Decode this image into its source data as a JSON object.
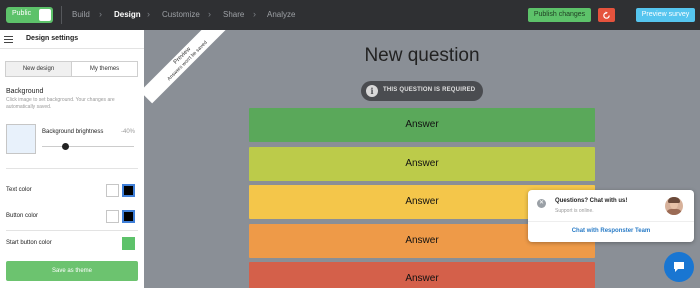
{
  "topbar": {
    "public_label": "Public",
    "nav": [
      {
        "label": "Build"
      },
      {
        "label": "Design"
      },
      {
        "label": "Customize"
      },
      {
        "label": "Share"
      },
      {
        "label": "Analyze"
      }
    ],
    "publish_label": "Publish changes",
    "preview_label": "Preview survey"
  },
  "sidebar": {
    "title": "Design settings",
    "tabs": [
      "New design",
      "My themes"
    ],
    "background_title": "Background",
    "background_desc": "Click image to set background. Your changes are automatically saved.",
    "brightness_label": "Background brightness",
    "brightness_value": "-40%",
    "brightness_fraction": 0.25,
    "text_color_label": "Text color",
    "button_color_label": "Button color",
    "start_button_color_label": "Start button color",
    "save_label": "Save as theme"
  },
  "preview": {
    "ribbon_line1": "Preview",
    "ribbon_line2": "Answers won't be saved",
    "question_title": "New question",
    "required_label": "THIS QUESTION IS REQUIRED",
    "answers": [
      {
        "label": "Answer",
        "color": "#5aa85a"
      },
      {
        "label": "Answer",
        "color": "#bccb4a"
      },
      {
        "label": "Answer",
        "color": "#f4c64a"
      },
      {
        "label": "Answer",
        "color": "#ee9a48"
      },
      {
        "label": "Answer",
        "color": "#d4604a"
      }
    ]
  },
  "chat": {
    "title": "Questions? Chat with us!",
    "status": "Support is online.",
    "link": "Chat with Responster Team"
  },
  "colors": {
    "green": "#5dc26a",
    "refresh": "#e5533d",
    "preview": "#56c5ef",
    "chat_blue": "#1976d2"
  }
}
